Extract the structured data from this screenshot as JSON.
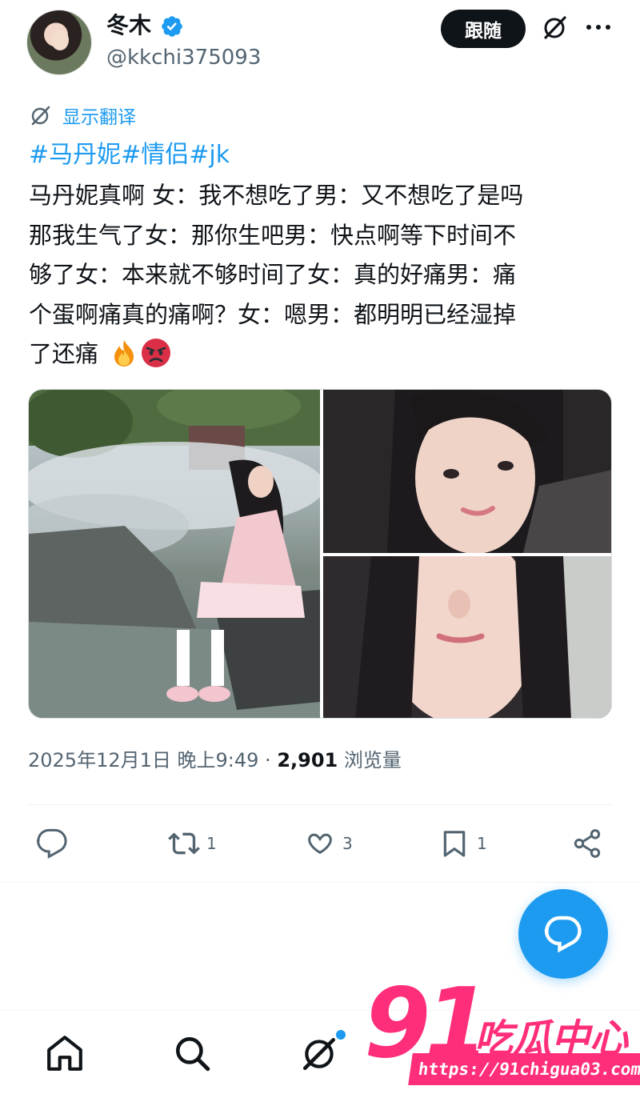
{
  "author": {
    "display_name": "冬木",
    "handle": "@kkchi375093",
    "verified": true
  },
  "header": {
    "follow_label": "跟随",
    "icons": [
      "grok-icon",
      "more-icon"
    ]
  },
  "translate_label": "显示翻译",
  "tweet": {
    "hashtags": "#马丹妮#情侣#jk",
    "lines": [
      "马丹妮真啊 女：我不想吃了男：又不想吃了是吗",
      "那我生气了女：那你生吧男：快点啊等下时间不",
      "够了女：本来就不够时间了女：真的好痛男：痛",
      "个蛋啊痛真的痛啊？女：嗯男：都明明已经湿掉",
      "了还痛"
    ],
    "emojis": [
      "fire",
      "angry-face"
    ],
    "photo_count": 3
  },
  "meta": {
    "timestamp": "2025年12月1日 晚上9:49",
    "separator": " · ",
    "views_count": "2,901",
    "views_label": "浏览量"
  },
  "actions": {
    "reply_count": "",
    "retweet_count": "1",
    "like_count": "3",
    "bookmark_count": "1"
  },
  "bottom_nav": [
    "home-icon",
    "search-icon",
    "grok-icon"
  ],
  "watermark": {
    "number": "91",
    "title": "吃瓜中心",
    "url": "https://91chigua03.com"
  },
  "colors": {
    "accent": "#1d9bf0",
    "text": "#0f1419",
    "secondary": "#536471",
    "watermark": "#ff2e7a"
  }
}
